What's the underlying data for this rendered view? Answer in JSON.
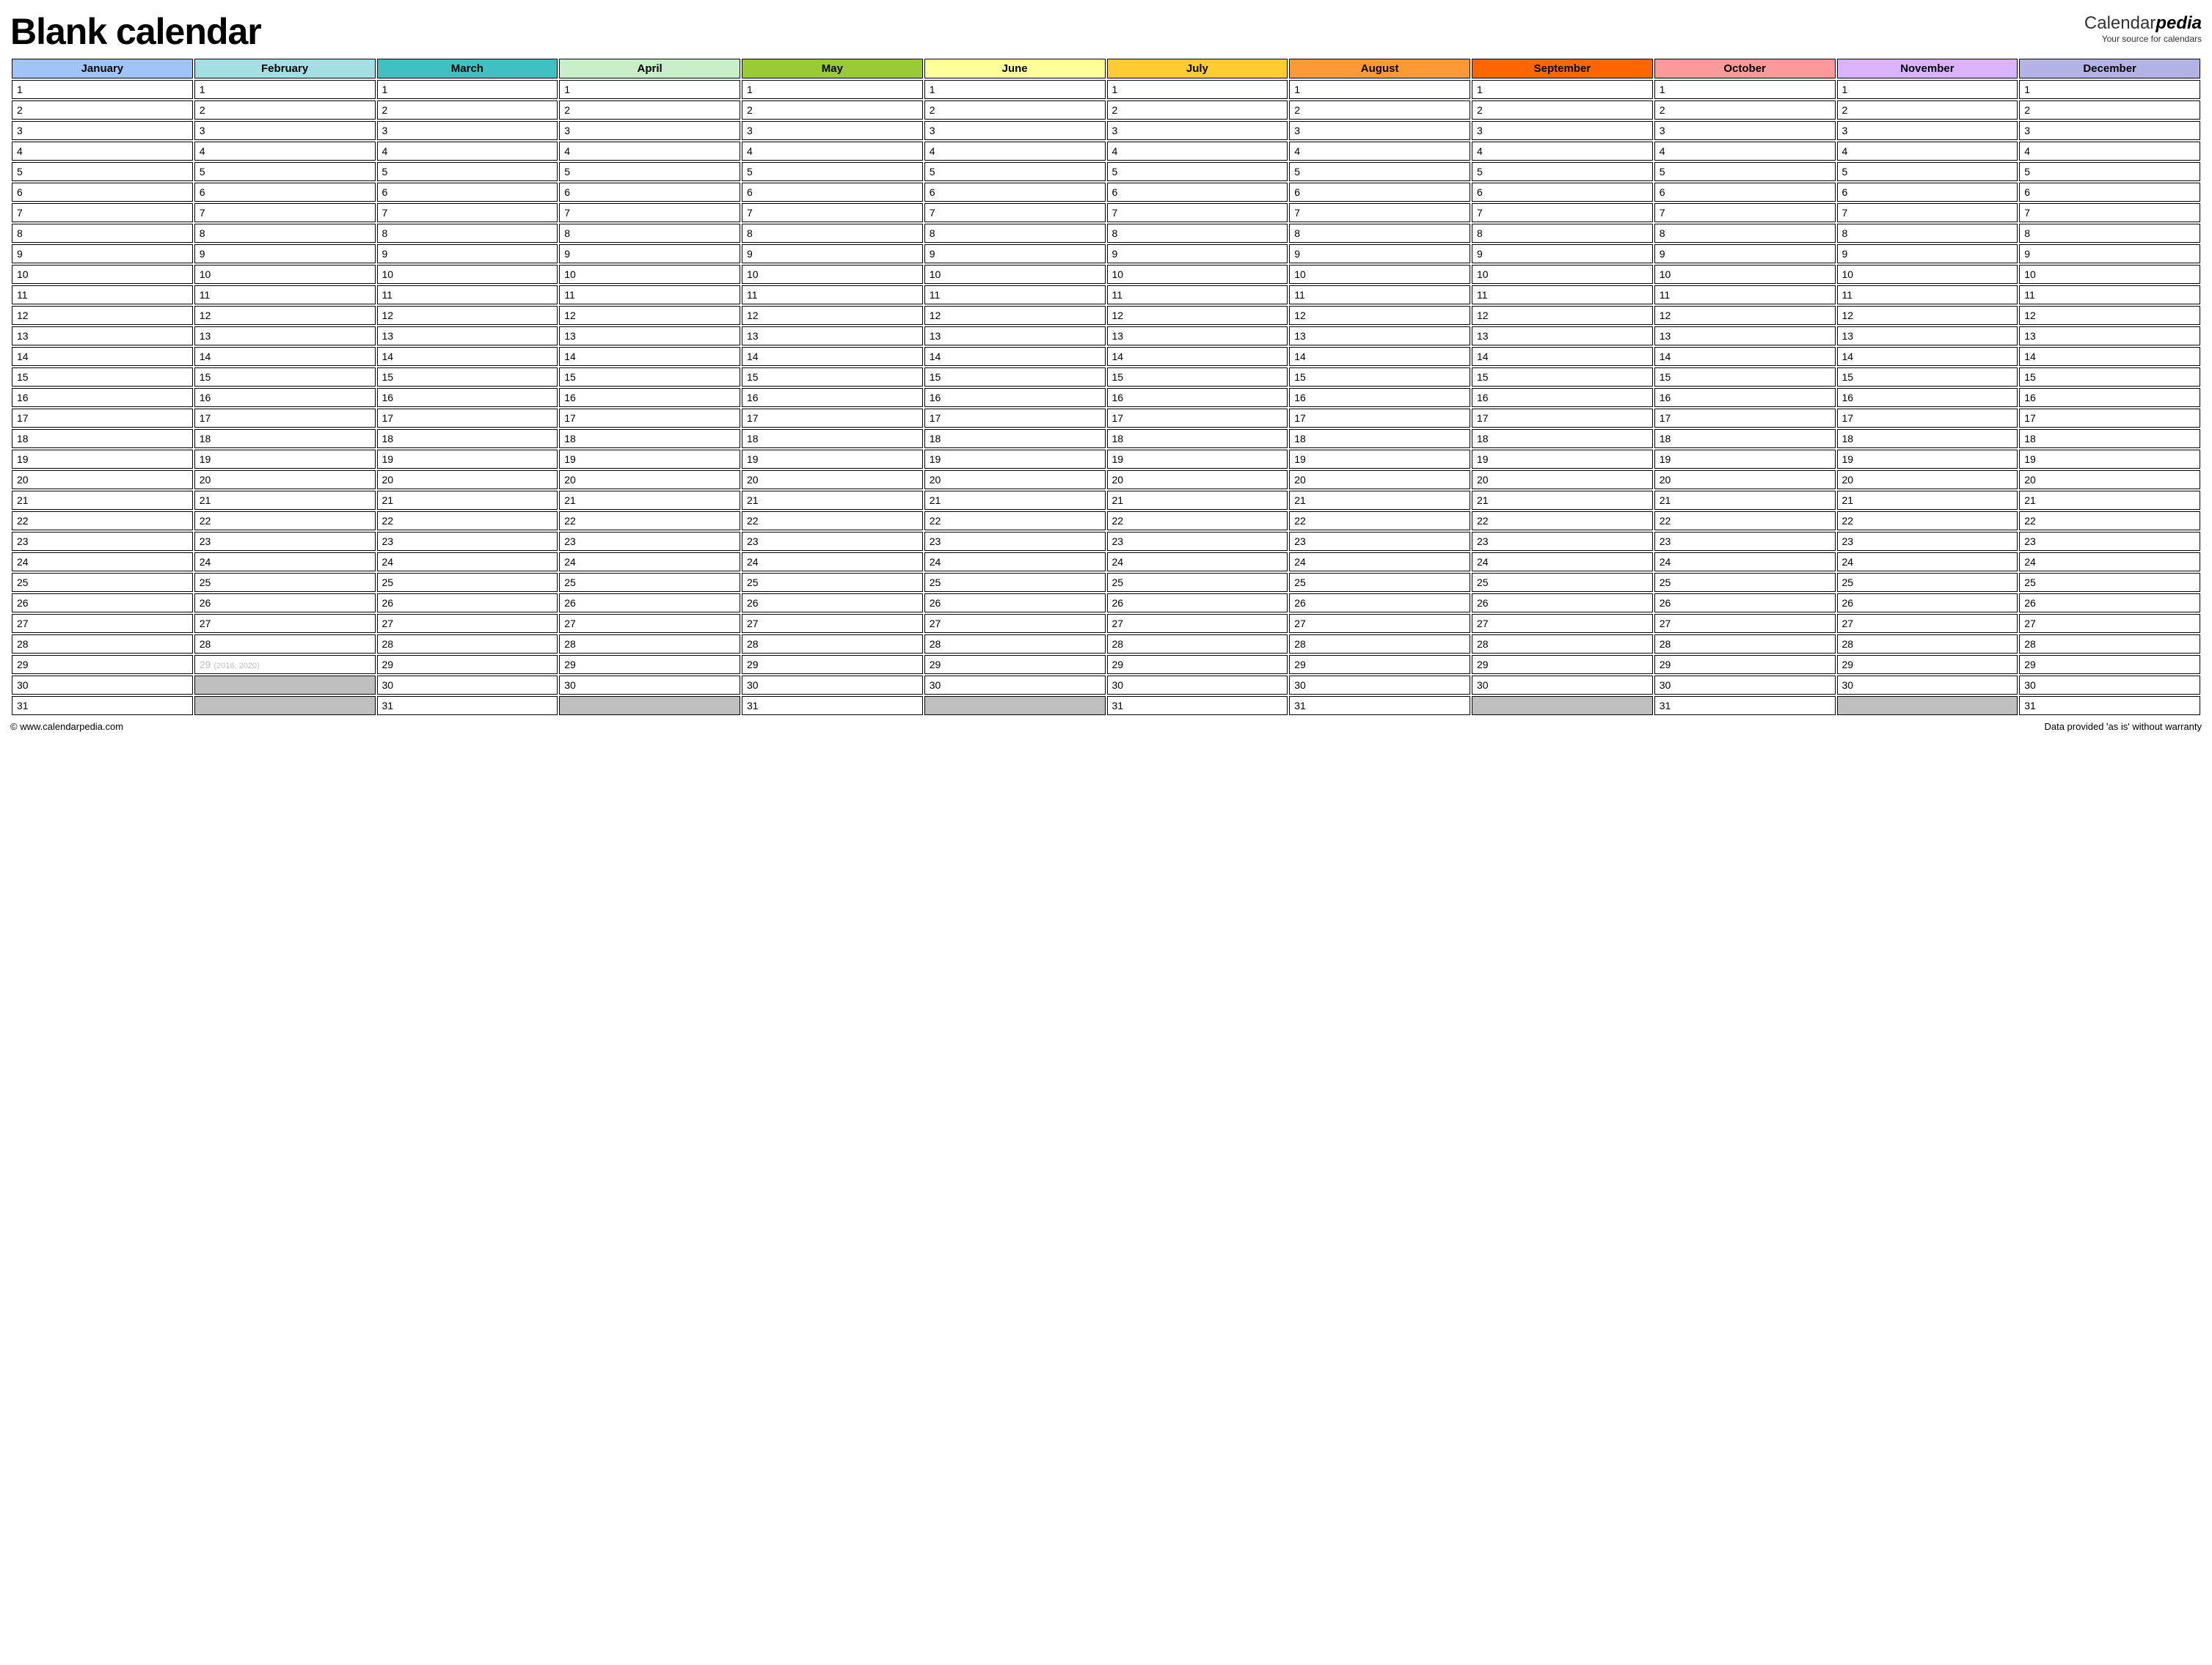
{
  "title": "Blank calendar",
  "brand": {
    "prefix": "Calendar",
    "highlight": "pedia",
    "tagline": "Your source for calendars"
  },
  "months": [
    {
      "name": "January",
      "color": "#9fc5f8",
      "maxDay": 31
    },
    {
      "name": "February",
      "color": "#a2e0e4",
      "maxDay": 28,
      "special": {
        "day": 29,
        "note": "(2016, 2020)",
        "dim": true
      }
    },
    {
      "name": "March",
      "color": "#40c0c0",
      "maxDay": 31
    },
    {
      "name": "April",
      "color": "#c8efc8",
      "maxDay": 30
    },
    {
      "name": "May",
      "color": "#99cc33",
      "maxDay": 31
    },
    {
      "name": "June",
      "color": "#ffff99",
      "maxDay": 30
    },
    {
      "name": "July",
      "color": "#ffcc33",
      "maxDay": 31
    },
    {
      "name": "August",
      "color": "#ff9933",
      "maxDay": 31
    },
    {
      "name": "September",
      "color": "#ff6600",
      "maxDay": 30
    },
    {
      "name": "October",
      "color": "#ff9999",
      "maxDay": 31
    },
    {
      "name": "November",
      "color": "#d9b3ff",
      "maxDay": 30
    },
    {
      "name": "December",
      "color": "#b3b3e6",
      "maxDay": 31
    }
  ],
  "maxRows": 31,
  "footer": {
    "left": "© www.calendarpedia.com",
    "right": "Data provided 'as is' without warranty"
  }
}
